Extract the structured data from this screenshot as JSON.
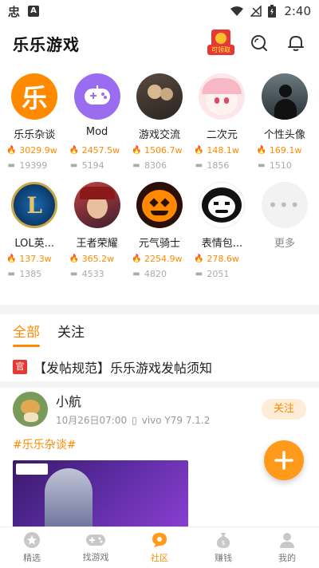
{
  "status_bar": {
    "time": "2:40",
    "left_icons": [
      "chinese-glyph",
      "a-icon"
    ]
  },
  "header": {
    "title": "乐乐游戏",
    "gift_label": "可领取"
  },
  "categories": [
    {
      "name": "乐乐杂谈",
      "heat": "3029.9w",
      "posts": "19399",
      "avatar": "le-logo"
    },
    {
      "name": "Mod",
      "heat": "2457.5w",
      "posts": "5194",
      "avatar": "gamepad-logo"
    },
    {
      "name": "游戏交流",
      "heat": "1506.7w",
      "posts": "8306",
      "avatar": "photo"
    },
    {
      "name": "二次元",
      "heat": "148.1w",
      "posts": "1856",
      "avatar": "anime-girl"
    },
    {
      "name": "个性头像",
      "heat": "169.1w",
      "posts": "1510",
      "avatar": "silhouette"
    },
    {
      "name": "LOL英...",
      "heat": "137.3w",
      "posts": "1385",
      "avatar": "lol-logo"
    },
    {
      "name": "王者荣耀",
      "heat": "365.2w",
      "posts": "4533",
      "avatar": "hero"
    },
    {
      "name": "元气骑士",
      "heat": "2254.9w",
      "posts": "4820",
      "avatar": "pumpkin"
    },
    {
      "name": "表情包...",
      "heat": "278.6w",
      "posts": "2051",
      "avatar": "meme"
    },
    {
      "name": "更多",
      "heat": "",
      "posts": "",
      "avatar": "more"
    }
  ],
  "tabs": [
    {
      "label": "全部",
      "active": true
    },
    {
      "label": "关注",
      "active": false
    }
  ],
  "notice": {
    "badge": "官",
    "text": "【发帖规范】乐乐游戏发帖须知"
  },
  "post": {
    "user": "小航",
    "time": "10月26日07:00",
    "device": "vivo Y79 7.1.2",
    "follow_label": "关注",
    "tag": "#乐乐杂谈#"
  },
  "nav": [
    {
      "label": "精选",
      "icon": "star-icon",
      "active": false
    },
    {
      "label": "找游戏",
      "icon": "gamepad-icon",
      "active": false
    },
    {
      "label": "社区",
      "icon": "chat-icon",
      "active": true
    },
    {
      "label": "赚钱",
      "icon": "moneybag-icon",
      "active": false
    },
    {
      "label": "我的",
      "icon": "person-icon",
      "active": false
    }
  ],
  "colors": {
    "accent": "#ff8a00",
    "official_red": "#e53935"
  }
}
